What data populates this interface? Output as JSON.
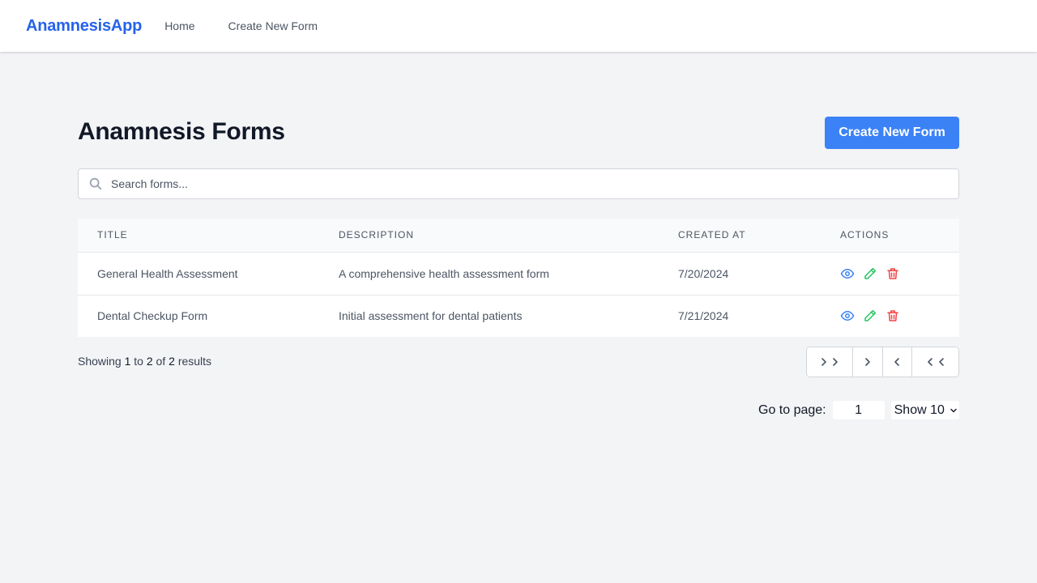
{
  "navbar": {
    "brand": "AnamnesisApp",
    "links": [
      "Home",
      "Create New Form"
    ]
  },
  "page": {
    "title": "Anamnesis Forms",
    "create_button": "Create New Form"
  },
  "search": {
    "placeholder": "Search forms...",
    "value": ""
  },
  "table": {
    "headers": [
      "Title",
      "Description",
      "Created At",
      "Actions"
    ],
    "rows": [
      {
        "title": "General Health Assessment",
        "description": "A comprehensive health assessment form",
        "created_at": "7/20/2024"
      },
      {
        "title": "Dental Checkup Form",
        "description": "Initial assessment for dental patients",
        "created_at": "7/21/2024"
      }
    ],
    "action_icons": [
      "eye-icon",
      "pencil-icon",
      "trash-icon"
    ]
  },
  "footer": {
    "showing_prefix": "Showing",
    "from": "1",
    "to_word": "to",
    "to": "2",
    "of_word": "of",
    "total": "2",
    "results_word": "results"
  },
  "pagination": {
    "buttons": [
      "chevrons-right-icon",
      "chevron-right-icon",
      "chevron-left-icon",
      "chevrons-left-icon"
    ],
    "goto_label": "Go to page:",
    "goto_value": "1",
    "page_size_label": "Show 10"
  },
  "colors": {
    "brand": "#2563eb",
    "primary_button": "#3b82f6",
    "view_icon": "#3b82f6",
    "edit_icon": "#22c55e",
    "delete_icon": "#ef4444",
    "background": "#f3f4f6"
  }
}
